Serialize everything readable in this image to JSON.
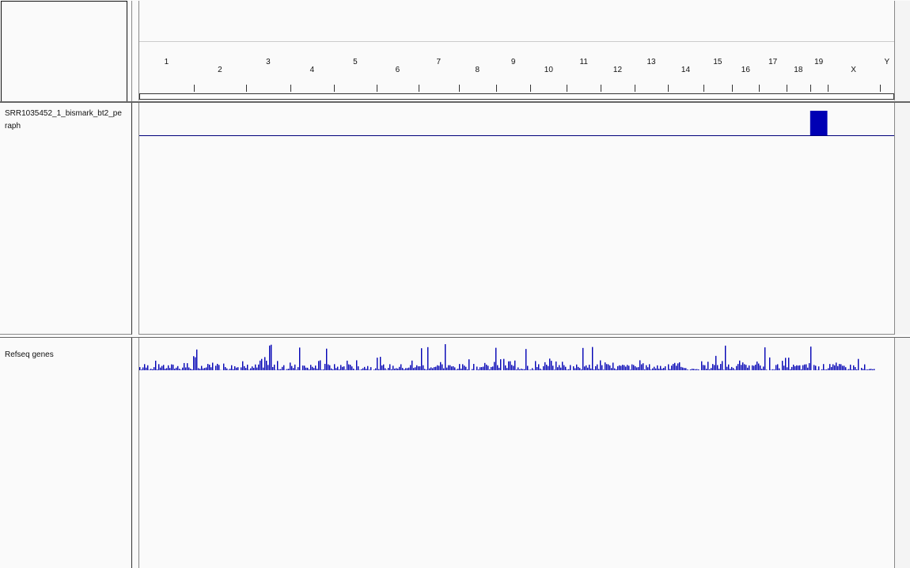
{
  "ruler": {
    "chromosomes": [
      {
        "name": "1",
        "start": 0,
        "end": 0.0722
      },
      {
        "name": "2",
        "start": 0.0722,
        "end": 0.1414
      },
      {
        "name": "3",
        "start": 0.1414,
        "end": 0.2001
      },
      {
        "name": "4",
        "start": 0.2001,
        "end": 0.2578
      },
      {
        "name": "5",
        "start": 0.2578,
        "end": 0.3144
      },
      {
        "name": "6",
        "start": 0.3144,
        "end": 0.3698
      },
      {
        "name": "7",
        "start": 0.3698,
        "end": 0.4232
      },
      {
        "name": "8",
        "start": 0.4232,
        "end": 0.4725
      },
      {
        "name": "9",
        "start": 0.4725,
        "end": 0.5183
      },
      {
        "name": "10",
        "start": 0.5183,
        "end": 0.5663
      },
      {
        "name": "11",
        "start": 0.5663,
        "end": 0.6114
      },
      {
        "name": "12",
        "start": 0.6114,
        "end": 0.6558
      },
      {
        "name": "13",
        "start": 0.6558,
        "end": 0.7006
      },
      {
        "name": "14",
        "start": 0.7006,
        "end": 0.7469
      },
      {
        "name": "15",
        "start": 0.7469,
        "end": 0.7854
      },
      {
        "name": "16",
        "start": 0.7854,
        "end": 0.8212
      },
      {
        "name": "17",
        "start": 0.8212,
        "end": 0.8573
      },
      {
        "name": "18",
        "start": 0.8573,
        "end": 0.8887
      },
      {
        "name": "19",
        "start": 0.8887,
        "end": 0.9115
      },
      {
        "name": "X",
        "start": 0.9115,
        "end": 0.9807
      },
      {
        "name": "Y",
        "start": 0.9807,
        "end": 1.0
      }
    ]
  },
  "tracks": {
    "coverage": {
      "name": "SRR1035452_1_bismark_bt2_pe",
      "name_wrap": "raph",
      "color": "#0000b4",
      "signal_region": {
        "chromosome": "19",
        "level": 1.0
      }
    },
    "genes": {
      "name": "Refseq genes",
      "color": "#0000b4"
    }
  }
}
